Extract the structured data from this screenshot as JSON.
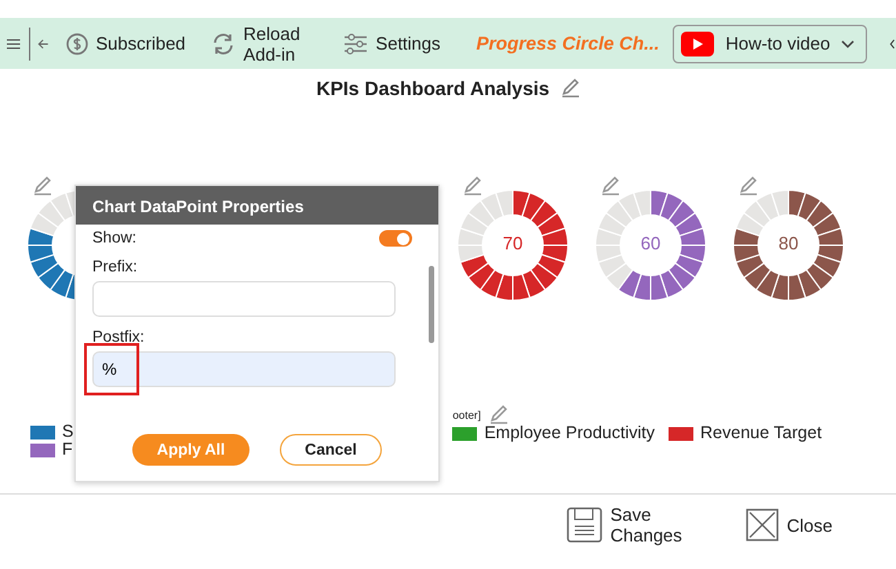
{
  "toolbar": {
    "items": [
      {
        "kind": "subscribed",
        "label": "Subscribed"
      },
      {
        "kind": "reload",
        "label": "Reload Add-in"
      },
      {
        "kind": "settings",
        "label": "Settings"
      }
    ],
    "app_title": "Progress Circle Ch...",
    "video_button": "How-to video"
  },
  "dashboard": {
    "title": "KPIs Dashboard Analysis",
    "donuts": [
      {
        "color": "#1f77b4",
        "level": 0.8
      },
      {
        "value": "70",
        "color": "#d62728",
        "level": 0.7
      },
      {
        "value": "60",
        "color": "#9467bd",
        "level": 0.6
      },
      {
        "value": "80",
        "color": "#8c564b",
        "level": 0.8
      }
    ],
    "legend": [
      {
        "label": "S",
        "color": "#1f77b4"
      },
      {
        "label": "F",
        "color": "#9467bd"
      },
      {
        "label": "Employee Productivity",
        "color": "#2ca02c"
      },
      {
        "label": "Revenue Target",
        "color": "#d62728"
      }
    ],
    "legend_fragment": "ooter]"
  },
  "dialog": {
    "title": "Chart DataPoint Properties",
    "show_label": "Show:",
    "show_on": true,
    "prefix_label": "Prefix:",
    "postfix_label": "Postfix:",
    "postfix_value": "%",
    "apply_button": "Apply All",
    "cancel_button": "Cancel"
  },
  "footer": {
    "save_button": "Save Changes",
    "close_button": "Close"
  }
}
